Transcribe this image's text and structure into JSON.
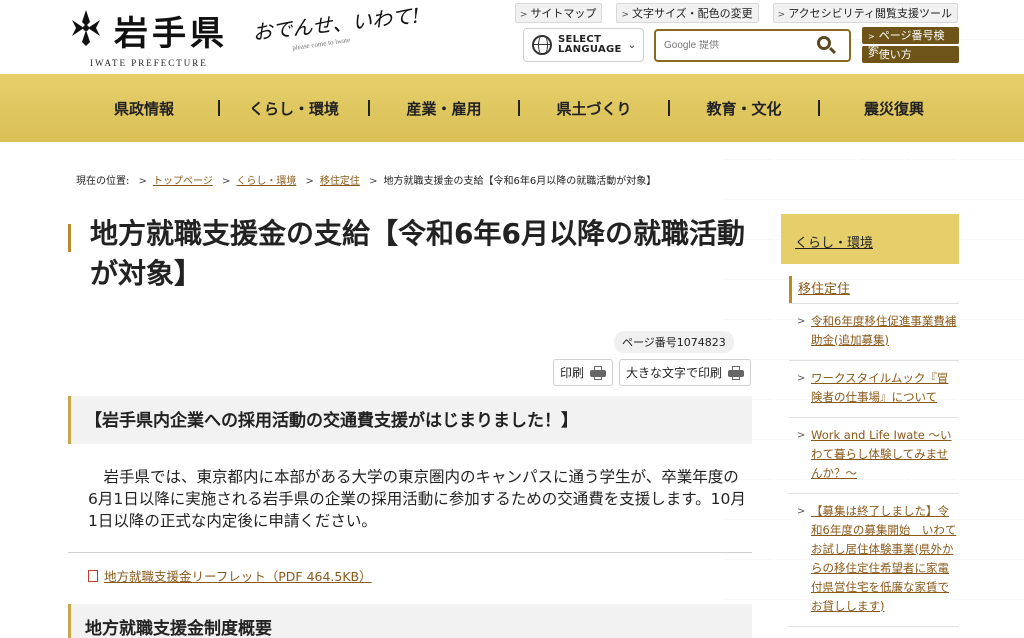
{
  "header": {
    "logo_title": "岩手県",
    "logo_sub": "IWATE PREFECTURE",
    "tagline": "おでんせ、いわて!",
    "tagline_sub": "please come to iwate",
    "util_links": [
      "サイトマップ",
      "文字サイズ・配色の変更",
      "アクセシビリティ閲覧支援ツール"
    ],
    "lang_line1": "SELECT",
    "lang_line2": "LANGUAGE",
    "search_placeholder": "Google 提供",
    "side_buttons": [
      "ページ番号検索",
      "使い方"
    ]
  },
  "nav": [
    "県政情報",
    "くらし・環境",
    "産業・雇用",
    "県土づくり",
    "教育・文化",
    "震災復興"
  ],
  "breadcrumb": {
    "label": "現在の位置:",
    "items": [
      "トップページ",
      "くらし・環境",
      "移住定住"
    ],
    "current": "地方就職支援金の支給【令和6年6月以降の就職活動が対象】"
  },
  "main": {
    "title": "地方就職支援金の支給【令和6年6月以降の就職活動が対象】",
    "page_number": "ページ番号1074823",
    "print_label": "印刷",
    "print_large_label": "大きな文字で印刷",
    "heading1": "【岩手県内企業への採用活動の交通費支援がはじまりました！】",
    "paragraph": "岩手県では、東京都内に本部がある大学の東京圏内のキャンパスに通う学生が、卒業年度の6月1日以降に実施される岩手県の企業の採用活動に参加するための交通費を支援します。10月1日以降の正式な内定後に申請ください。",
    "pdf_link": "地方就職支援金リーフレット（PDF 464.5KB）",
    "heading2": "地方就職支援金制度概要"
  },
  "sidebar": {
    "head": "くらし・環境",
    "category": "移住定住",
    "items": [
      "令和6年度移住促進事業費補助金(追加募集)",
      "ワークスタイルムック『冒険者の仕事場』について",
      "Work and Life Iwate ～いわて暮らし体験してみませんか？～",
      "【募集は終了しました】令和6年度の募集開始　いわてお試し居住体験事業(県外からの移住定住希望者に家電付県営住宅を低廉な家賃でお貸しします)"
    ]
  }
}
